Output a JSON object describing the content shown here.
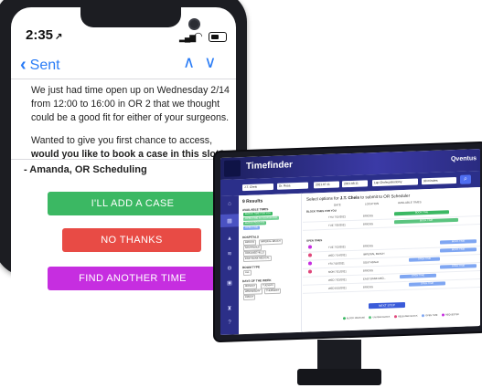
{
  "phone": {
    "time": "2:35",
    "time_arrow": "↗",
    "back_label": "Sent",
    "nav_up": "∧",
    "nav_down": "∨",
    "message_p1": "We just had time open up on Wednesday 2/14 from 12:00 to 16:00 in OR 2 that we thought could be a good fit for either of your surgeons.",
    "message_p2_start": "Wanted to give you first chance to access, ",
    "message_p2_bold": "would you like to book a case in this slot?",
    "signature": "- Amanda, OR Scheduling",
    "buttons": {
      "add_case": "I'LL ADD A CASE",
      "no_thanks": "NO THANKS",
      "find_time": "FIND ANOTHER TIME"
    },
    "colors": {
      "green": "#3bb863",
      "red": "#e84b45",
      "purple": "#c62ee0",
      "link": "#2a7cf6"
    }
  },
  "timefinder": {
    "app_title": "Timefinder",
    "brand": "Qventus",
    "filters": [
      "J.T. Cheis",
      "Dr. Rosa",
      "2021.07.11",
      "2021.08.11",
      "Lap Cholecystectomy",
      "90 minutes"
    ],
    "search_icon": "search-icon",
    "sidebar_icons": [
      "home-icon",
      "calendar-icon",
      "chart-icon",
      "flow-icon",
      "settings-icon",
      "grid-icon",
      "trophy-icon",
      "help-icon"
    ],
    "left": {
      "results": "9 Results",
      "available_times": "AVAILABLE TIMES",
      "time_chips": [
        "BLOCK TIME FOR YOU",
        "OPEN TIME IN YOUR BLOCK",
        "BLOCK RELEASE",
        "OPEN TIME"
      ],
      "hospitals": "HOSPITALS",
      "hospital_chips": [
        "BRIGGS",
        "IMPERIAL BEACH",
        "SOUTHDALE",
        "PARADISE HILLS",
        "EAST BANK MEDICAL"
      ],
      "room_type": "ROOM TYPE",
      "room_chip": "ALL",
      "days_of_week": "DAYS OF THE WEEK",
      "day_chips": [
        "MONDAY",
        "TUESDAY",
        "WEDNESDAY",
        "THURSDAY",
        "FRIDAY"
      ]
    },
    "main": {
      "title_start": "Select options for ",
      "title_bold": "J.T. Cheis",
      "title_end": " to submit to OR Scheduler",
      "headers": [
        "DATE",
        "LOCATION",
        "AVAILABLE TIMES"
      ],
      "section_block": "BLOCK TIMES FOR YOU",
      "section_open": "OPEN TIMES",
      "rows_block": [
        {
          "date": "THU 7/15/2021",
          "location": "BRIGGS",
          "bar": "BOOK TIME"
        },
        {
          "date": "TUE 7/20/2021",
          "location": "BRIGGS",
          "bar": "BOOK TIME"
        }
      ],
      "rows_open": [
        {
          "date": "TUE 7/13/2021",
          "location": "BRIGGS",
          "bar": "BOOK TIME"
        },
        {
          "date": "WED 7/14/2021",
          "location": "IMPERIAL BEACH",
          "bar": "BOOK TIME"
        },
        {
          "date": "FRI 7/16/2021",
          "location": "SOUTHDALE",
          "bar": "OPEN TIME"
        },
        {
          "date": "MON 7/21/2021",
          "location": "BRIGGS",
          "bar": "OPEN TIME"
        },
        {
          "date": "WED 7/23/2021",
          "location": "EAST BANK MED...",
          "bar": "OPEN TIME"
        },
        {
          "date": "WED 8/10/2021",
          "location": "BRIGGS",
          "bar": "OPEN TIME"
        }
      ],
      "next_step": "NEXT STEP",
      "legend": [
        "BLOCK RELEASE",
        "UNUSED BLOCK",
        "RELEASED BLOCK",
        "OPEN TIME",
        "REQUESTED"
      ]
    },
    "colors": {
      "header": "#2b2f8a",
      "block_green": "#3bb863",
      "open_blue": "#7fa6f2",
      "accent": "#3a5bd9"
    }
  }
}
